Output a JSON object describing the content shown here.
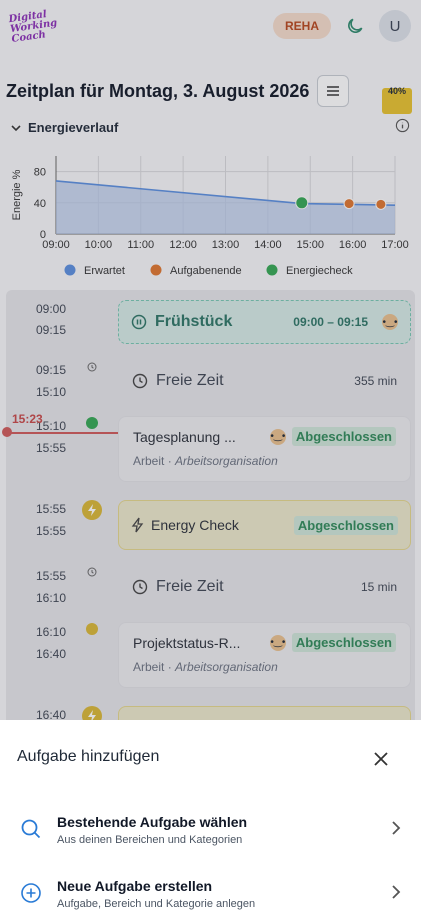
{
  "header": {
    "logo_lines": [
      "Digital",
      "Working",
      "Coach"
    ],
    "badge": "REHA",
    "avatar_initial": "U"
  },
  "page": {
    "title": "Zeitplan für Montag, 3. August 2026",
    "battery": "40%"
  },
  "energy": {
    "title": "Energieverlauf"
  },
  "chart_data": {
    "type": "line",
    "ylabel": "Energie %",
    "x_ticks": [
      "09:00",
      "10:00",
      "11:00",
      "12:00",
      "13:00",
      "14:00",
      "15:00",
      "16:00",
      "17:00"
    ],
    "y_ticks": [
      0,
      40,
      80
    ],
    "ylim": [
      0,
      100
    ],
    "series": [
      {
        "name": "Erwartet",
        "x": [
          "09:00",
          "14:48",
          "17:00"
        ],
        "y": [
          68,
          39,
          37
        ]
      }
    ],
    "events": [
      {
        "name": "Energiecheck",
        "time": "14:48",
        "y": 40
      },
      {
        "name": "Aufgabenende",
        "time": "15:55",
        "y": 39
      },
      {
        "name": "Aufgabenende",
        "time": "16:40",
        "y": 38
      }
    ],
    "legend": [
      {
        "label": "Erwartet",
        "color": "#5b8fe0"
      },
      {
        "label": "Aufgabenende",
        "color": "#e0762e"
      },
      {
        "label": "Energiecheck",
        "color": "#34a853"
      }
    ]
  },
  "timeline": {
    "now": "15:23",
    "items": [
      {
        "start": "09:00",
        "end": "09:15",
        "label": "Frühstück",
        "range": "09:00 – 09:15"
      },
      {
        "start": "09:15",
        "end": "15:10",
        "label": "Freie Zeit",
        "duration": "355 min"
      },
      {
        "start": "15:10",
        "end": "15:55",
        "label": "Tagesplanung ...",
        "status": "Abgeschlossen",
        "area": "Arbeit",
        "category": "Arbeitsorganisation"
      },
      {
        "start": "15:55",
        "end": "15:55",
        "label": "Energy Check",
        "status": "Abgeschlossen"
      },
      {
        "start": "15:55",
        "end": "16:10",
        "label": "Freie Zeit",
        "duration": "15 min"
      },
      {
        "start": "16:10",
        "end": "16:40",
        "label": "Projektstatus-R...",
        "status": "Abgeschlossen",
        "area": "Arbeit",
        "category": "Arbeitsorganisation"
      },
      {
        "start": "16:40"
      }
    ]
  },
  "sheet": {
    "title": "Aufgabe hinzufügen",
    "items": [
      {
        "label": "Bestehende Aufgabe wählen",
        "sub": "Aus deinen Bereichen und Kategorien"
      },
      {
        "label": "Neue Aufgabe erstellen",
        "sub": "Aufgabe, Bereich und Kategorie anlegen"
      }
    ]
  },
  "colors": {
    "accent": "#2a7bd6",
    "reha_bg": "#f6dccb",
    "done": "#2f8a5a",
    "now": "#c94848"
  }
}
